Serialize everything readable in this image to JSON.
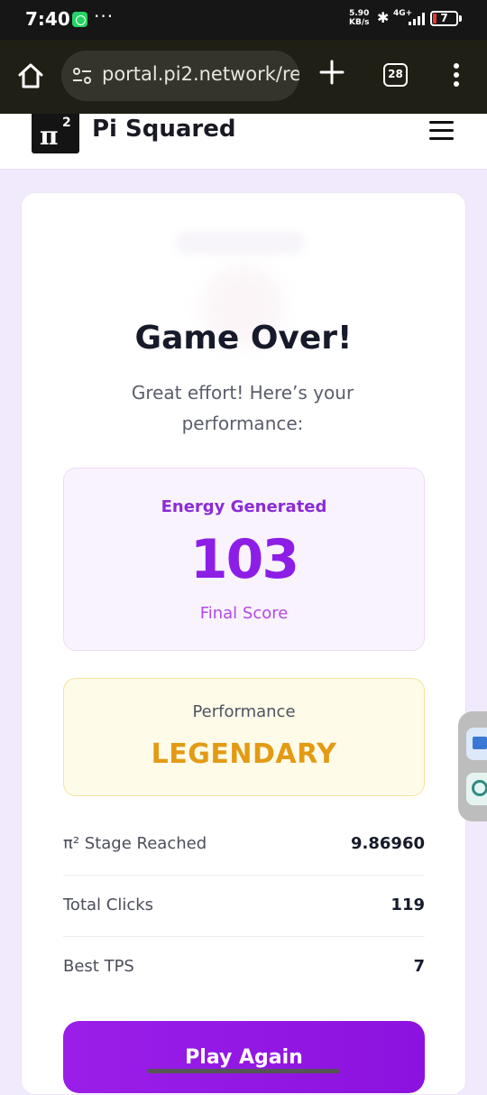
{
  "status_bar": {
    "time": "7:40",
    "dots": "···",
    "speed_value": "5.90",
    "speed_unit": "KB/s",
    "network": "4G+",
    "battery": "7"
  },
  "browser": {
    "url": "portal.pi2.network/re",
    "tab_count": "28"
  },
  "site": {
    "logo_symbol": "π",
    "logo_sup": "2",
    "brand_name": "Pi Squared"
  },
  "game_over": {
    "title": "Game Over!",
    "subtitle": "Great effort! Here’s your performance:",
    "score": {
      "label": "Energy Generated",
      "value": "103",
      "caption": "Final Score"
    },
    "performance": {
      "label": "Performance",
      "rating": "LEGENDARY"
    },
    "stats": [
      {
        "name": "π² Stage Reached",
        "value": "9.86960"
      },
      {
        "name": "Total Clicks",
        "value": "119"
      },
      {
        "name": "Best TPS",
        "value": "7"
      }
    ],
    "play_again_label": "Play Again"
  },
  "colors": {
    "accent_purple": "#8d1ee6",
    "legendary_gold": "#e39b15",
    "page_bg": "#f1eafd"
  }
}
